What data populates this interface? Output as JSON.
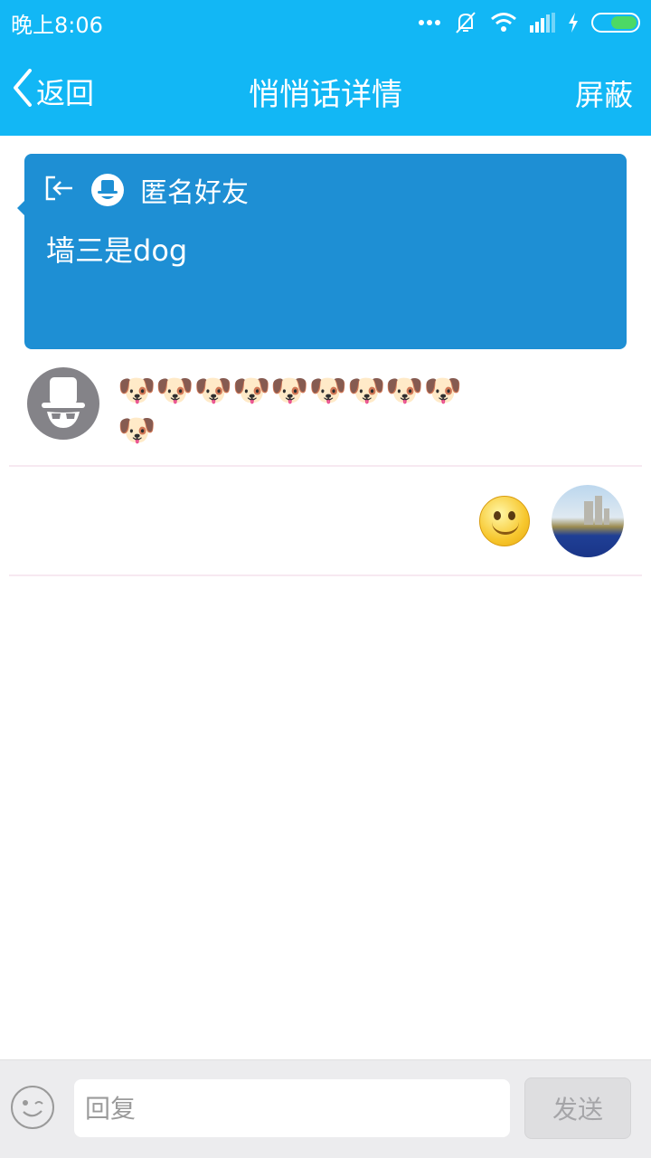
{
  "status_bar": {
    "time": "晚上8:06",
    "icons": [
      "more-dots-icon",
      "bell-muted-icon",
      "wifi-icon",
      "signal-icon",
      "charging-icon",
      "battery-icon"
    ],
    "battery_color": "#4cd964"
  },
  "nav": {
    "back_label": "返回",
    "title": "悄悄话详情",
    "block_label": "屏蔽",
    "bg_color": "#12b7f5"
  },
  "message": {
    "sender": "匿名好友",
    "text": "墙三是dog",
    "bg_color": "#1e8fd4"
  },
  "replies": [
    {
      "from": "anonymous",
      "line1": "🐶🐶🐶🐶🐶🐶🐶🐶🐶",
      "line2": "🐶"
    },
    {
      "from": "me",
      "content": "smiley-emoticon"
    }
  ],
  "input": {
    "placeholder": "回复",
    "value": "",
    "send_label": "发送"
  }
}
